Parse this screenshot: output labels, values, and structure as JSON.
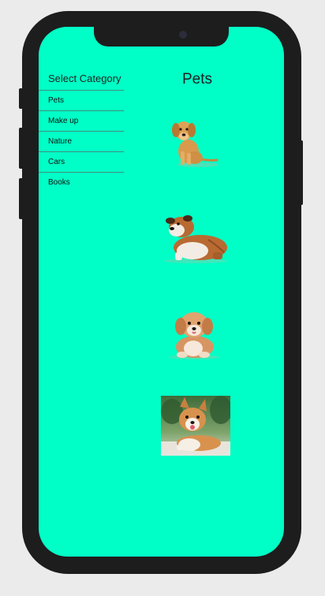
{
  "sidebar": {
    "title": "Select Category",
    "items": [
      {
        "label": "Pets"
      },
      {
        "label": "Make up"
      },
      {
        "label": "Nature"
      },
      {
        "label": "Cars"
      },
      {
        "label": "Books"
      }
    ]
  },
  "main": {
    "title": "Pets",
    "images": [
      {
        "name": "golden-retriever-puppy"
      },
      {
        "name": "bulldog-puppy"
      },
      {
        "name": "fluffy-puppy"
      },
      {
        "name": "corgi-puppy"
      }
    ]
  },
  "colors": {
    "screen_background": "#00ffc6",
    "frame": "#1d1d1d",
    "page_background": "#ebebeb",
    "divider": "#3f8f7d"
  }
}
